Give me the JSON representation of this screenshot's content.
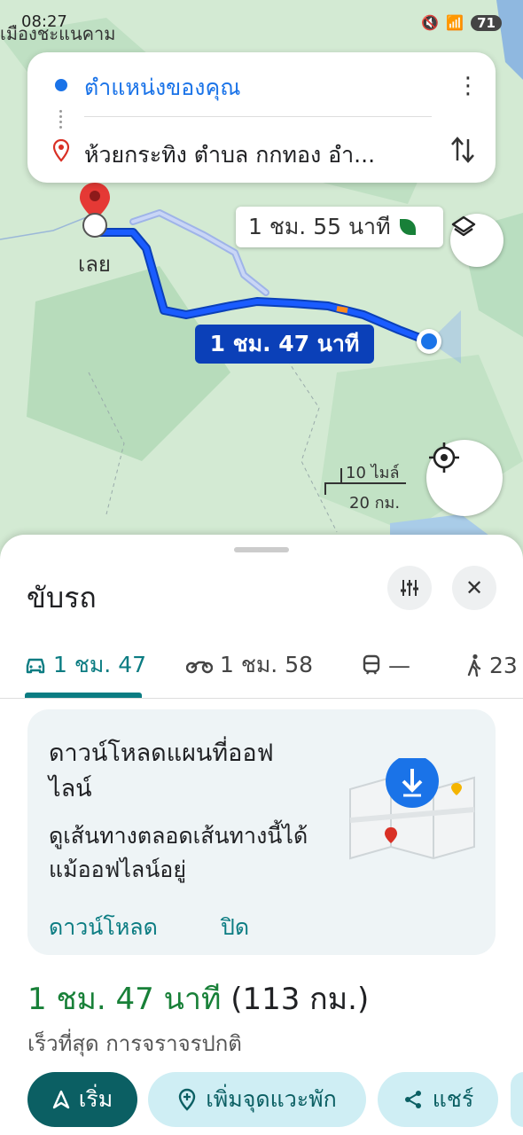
{
  "status_bar": {
    "time": "08:27",
    "city": "เมืองชะแนคาม",
    "battery": "71"
  },
  "search": {
    "origin": "ตำแหน่งของคุณ",
    "destination": "ห้วยกระทิง ตำบล กกทอง อำ..."
  },
  "map": {
    "alt_route_time": "1 ชม. 55 นาที",
    "main_route_time": "1 ชม. 47 นาที",
    "city_label": "เลย",
    "scale_miles": "10 ไมล์",
    "scale_km": "20 กม."
  },
  "sheet": {
    "title": "ขับรถ",
    "tabs": [
      {
        "icon": "car-icon",
        "label": "1 ชม. 47"
      },
      {
        "icon": "motorcycle-icon",
        "label": "1 ชม. 58"
      },
      {
        "icon": "train-icon",
        "label": "—"
      },
      {
        "icon": "walk-icon",
        "label": "23"
      }
    ],
    "offline_card": {
      "title": "ดาวน์โหลดแผนที่ออฟไลน์",
      "subtitle": "ดูเส้นทางตลอดเส้นทางนี้ได้แม้ออฟไลน์อยู่",
      "download": "ดาวน์โหลด",
      "close": "ปิด"
    },
    "summary_time": "1 ชม. 47 นาที",
    "summary_distance": "(113 กม.)",
    "summary_detail": "เร็วที่สุด การจราจรปกติ",
    "actions": {
      "start": "เริ่ม",
      "add_stop": "เพิ่มจุดแวะพัก",
      "share": "แชร์"
    }
  },
  "colors": {
    "accent": "#0b7c82",
    "route": "#0b40b8",
    "green": "#188038"
  }
}
